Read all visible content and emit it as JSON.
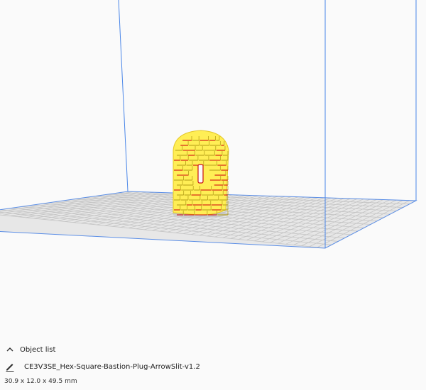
{
  "object_list": {
    "header_label": "Object list",
    "expand_icon": "chevron-up-icon"
  },
  "object": {
    "name": "CE3V3SE_Hex-Square-Bastion-Plug-ArrowSlit-v1.2",
    "edit_icon": "pencil-icon",
    "dimensions": "30.9 x 12.0 x 49.5 mm"
  },
  "colors": {
    "background": "#fafafa",
    "build_volume_edge": "#3b7de0",
    "build_plate": "#d4d4d4",
    "model_fill": "#ffee55",
    "model_overhang": "#d01010"
  }
}
